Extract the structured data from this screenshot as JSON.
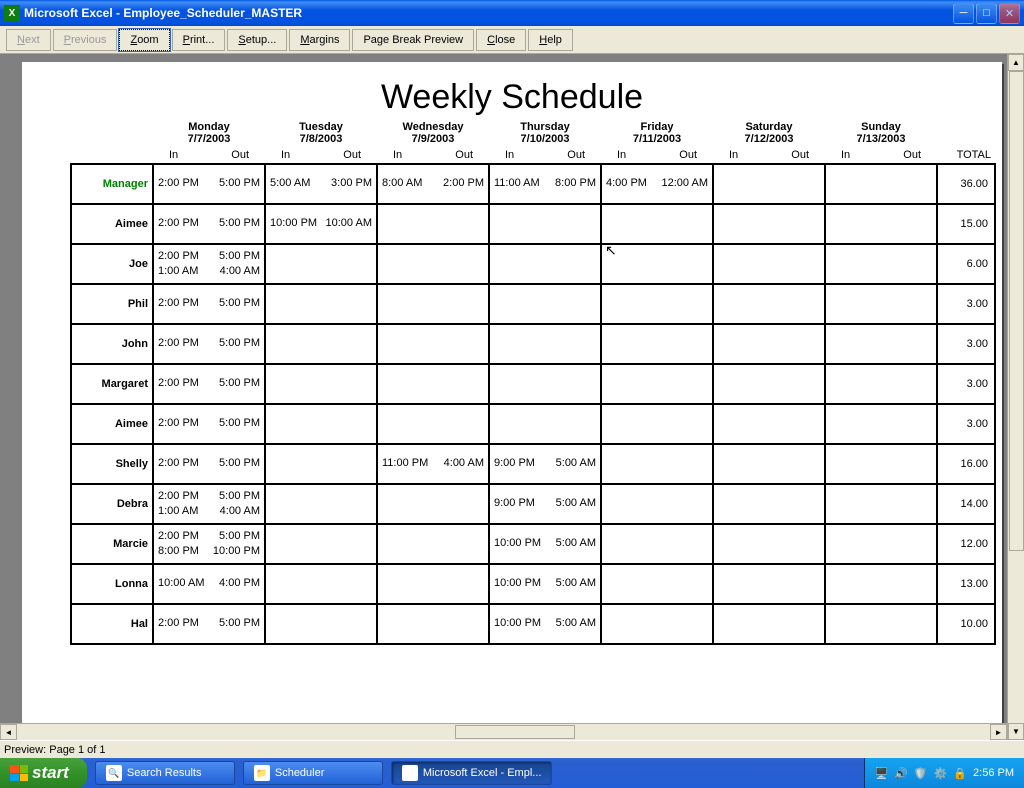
{
  "titlebar": {
    "app": "Microsoft Excel",
    "doc": "Employee_Scheduler_MASTER"
  },
  "toolbar": {
    "next": "Next",
    "previous": "Previous",
    "zoom": "Zoom",
    "print": "Print...",
    "setup": "Setup...",
    "margins": "Margins",
    "pagebreak": "Page Break Preview",
    "close": "Close",
    "help": "Help"
  },
  "schedule": {
    "title": "Weekly Schedule",
    "total_label": "TOTAL",
    "in_label": "In",
    "out_label": "Out",
    "days": [
      {
        "name": "Monday",
        "date": "7/7/2003"
      },
      {
        "name": "Tuesday",
        "date": "7/8/2003"
      },
      {
        "name": "Wednesday",
        "date": "7/9/2003"
      },
      {
        "name": "Thursday",
        "date": "7/10/2003"
      },
      {
        "name": "Friday",
        "date": "7/11/2003"
      },
      {
        "name": "Saturday",
        "date": "7/12/2003"
      },
      {
        "name": "Sunday",
        "date": "7/13/2003"
      }
    ],
    "rows": [
      {
        "name": "Manager",
        "mgr": true,
        "total": "36.00",
        "shifts": [
          [
            {
              "in": "2:00 PM",
              "out": "5:00 PM"
            }
          ],
          [
            {
              "in": "5:00 AM",
              "out": "3:00 PM"
            }
          ],
          [
            {
              "in": "8:00 AM",
              "out": "2:00 PM"
            }
          ],
          [
            {
              "in": "11:00 AM",
              "out": "8:00 PM"
            }
          ],
          [
            {
              "in": "4:00 PM",
              "out": "12:00 AM"
            }
          ],
          [],
          []
        ]
      },
      {
        "name": "Aimee",
        "total": "15.00",
        "shifts": [
          [
            {
              "in": "2:00 PM",
              "out": "5:00 PM"
            }
          ],
          [
            {
              "in": "10:00 PM",
              "out": "10:00 AM"
            }
          ],
          [],
          [],
          [],
          [],
          []
        ]
      },
      {
        "name": "Joe",
        "total": "6.00",
        "shifts": [
          [
            {
              "in": "2:00 PM",
              "out": "5:00 PM"
            },
            {
              "in": "1:00 AM",
              "out": "4:00 AM"
            }
          ],
          [],
          [],
          [],
          [],
          [],
          []
        ]
      },
      {
        "name": "Phil",
        "total": "3.00",
        "shifts": [
          [
            {
              "in": "2:00 PM",
              "out": "5:00 PM"
            }
          ],
          [],
          [],
          [],
          [],
          [],
          []
        ]
      },
      {
        "name": "John",
        "total": "3.00",
        "shifts": [
          [
            {
              "in": "2:00 PM",
              "out": "5:00 PM"
            }
          ],
          [],
          [],
          [],
          [],
          [],
          []
        ]
      },
      {
        "name": "Margaret",
        "total": "3.00",
        "shifts": [
          [
            {
              "in": "2:00 PM",
              "out": "5:00 PM"
            }
          ],
          [],
          [],
          [],
          [],
          [],
          []
        ]
      },
      {
        "name": "Aimee",
        "total": "3.00",
        "shifts": [
          [
            {
              "in": "2:00 PM",
              "out": "5:00 PM"
            }
          ],
          [],
          [],
          [],
          [],
          [],
          []
        ]
      },
      {
        "name": "Shelly",
        "total": "16.00",
        "shifts": [
          [
            {
              "in": "2:00 PM",
              "out": "5:00 PM"
            }
          ],
          [],
          [
            {
              "in": "11:00 PM",
              "out": "4:00 AM"
            }
          ],
          [
            {
              "in": "9:00 PM",
              "out": "5:00 AM"
            }
          ],
          [],
          [],
          []
        ]
      },
      {
        "name": "Debra",
        "total": "14.00",
        "shifts": [
          [
            {
              "in": "2:00 PM",
              "out": "5:00 PM"
            },
            {
              "in": "1:00 AM",
              "out": "4:00 AM"
            }
          ],
          [],
          [],
          [
            {
              "in": "9:00 PM",
              "out": "5:00 AM"
            }
          ],
          [],
          [],
          []
        ]
      },
      {
        "name": "Marcie",
        "total": "12.00",
        "shifts": [
          [
            {
              "in": "2:00 PM",
              "out": "5:00 PM"
            },
            {
              "in": "8:00 PM",
              "out": "10:00 PM"
            }
          ],
          [],
          [],
          [
            {
              "in": "10:00 PM",
              "out": "5:00 AM"
            }
          ],
          [],
          [],
          []
        ]
      },
      {
        "name": "Lonna",
        "total": "13.00",
        "shifts": [
          [
            {
              "in": "10:00 AM",
              "out": "4:00 PM"
            }
          ],
          [],
          [],
          [
            {
              "in": "10:00 PM",
              "out": "5:00 AM"
            }
          ],
          [],
          [],
          []
        ]
      },
      {
        "name": "Hal",
        "total": "10.00",
        "shifts": [
          [
            {
              "in": "2:00 PM",
              "out": "5:00 PM"
            }
          ],
          [],
          [],
          [
            {
              "in": "10:00 PM",
              "out": "5:00 AM"
            }
          ],
          [],
          [],
          []
        ]
      }
    ]
  },
  "statusbar": {
    "text": "Preview: Page 1 of 1"
  },
  "taskbar": {
    "start": "start",
    "items": [
      {
        "label": "Search Results",
        "icon": "🔍",
        "active": false
      },
      {
        "label": "Scheduler",
        "icon": "📁",
        "active": false
      },
      {
        "label": "Microsoft Excel - Empl...",
        "icon": "X",
        "active": true
      }
    ],
    "clock": "2:56 PM"
  }
}
